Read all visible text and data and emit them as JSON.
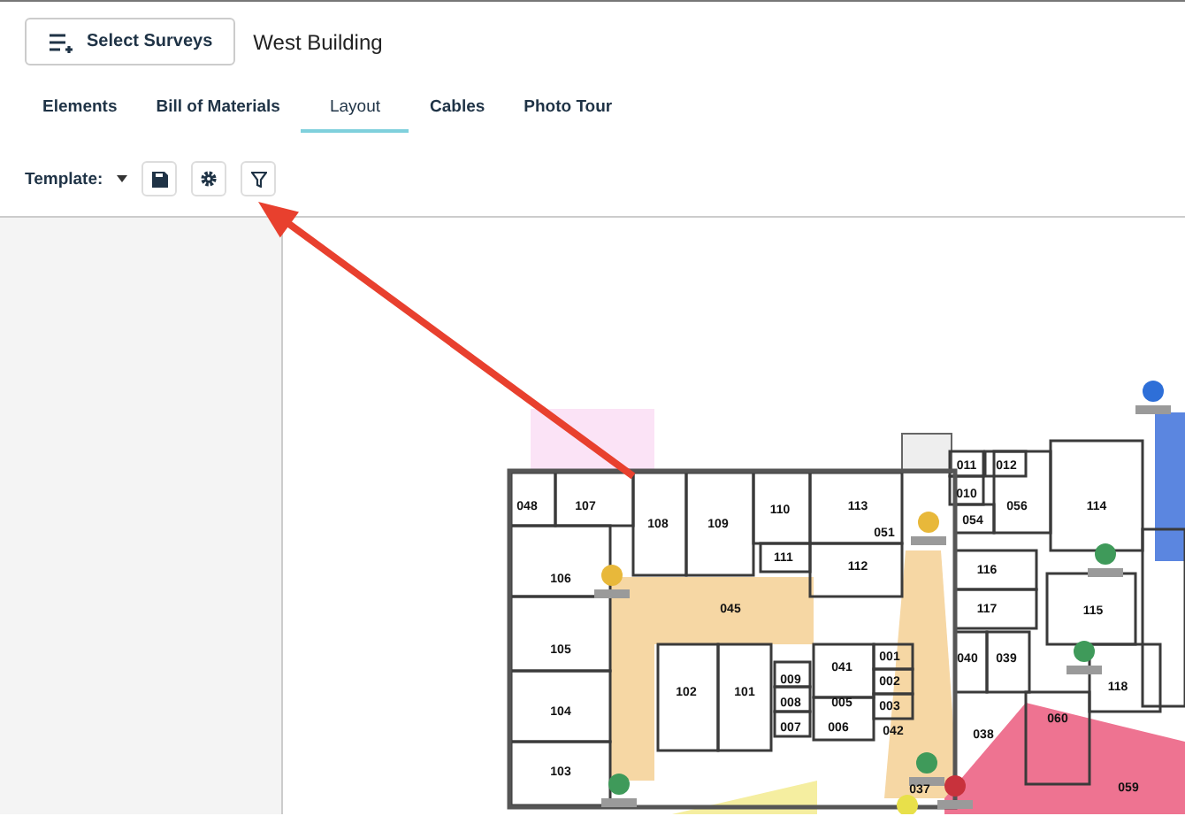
{
  "header": {
    "button": "Select Surveys",
    "title": "West Building"
  },
  "tabs": [
    {
      "label": "Elements",
      "selected": false
    },
    {
      "label": "Bill of Materials",
      "selected": false
    },
    {
      "label": "Layout",
      "selected": true
    },
    {
      "label": "Cables",
      "selected": false
    },
    {
      "label": "Photo Tour",
      "selected": false
    }
  ],
  "toolbar": {
    "label": "Template:"
  },
  "floor_plan": {
    "rooms": [
      "048",
      "107",
      "108",
      "109",
      "110",
      "113",
      "111",
      "112",
      "106",
      "045",
      "105",
      "104",
      "103",
      "102",
      "101",
      "009",
      "008",
      "007",
      "041",
      "005",
      "006",
      "001",
      "002",
      "003",
      "042",
      "051",
      "011",
      "012",
      "010",
      "054",
      "056",
      "114",
      "116",
      "117",
      "115",
      "040",
      "039",
      "118",
      "060",
      "038",
      "037",
      "059"
    ]
  }
}
